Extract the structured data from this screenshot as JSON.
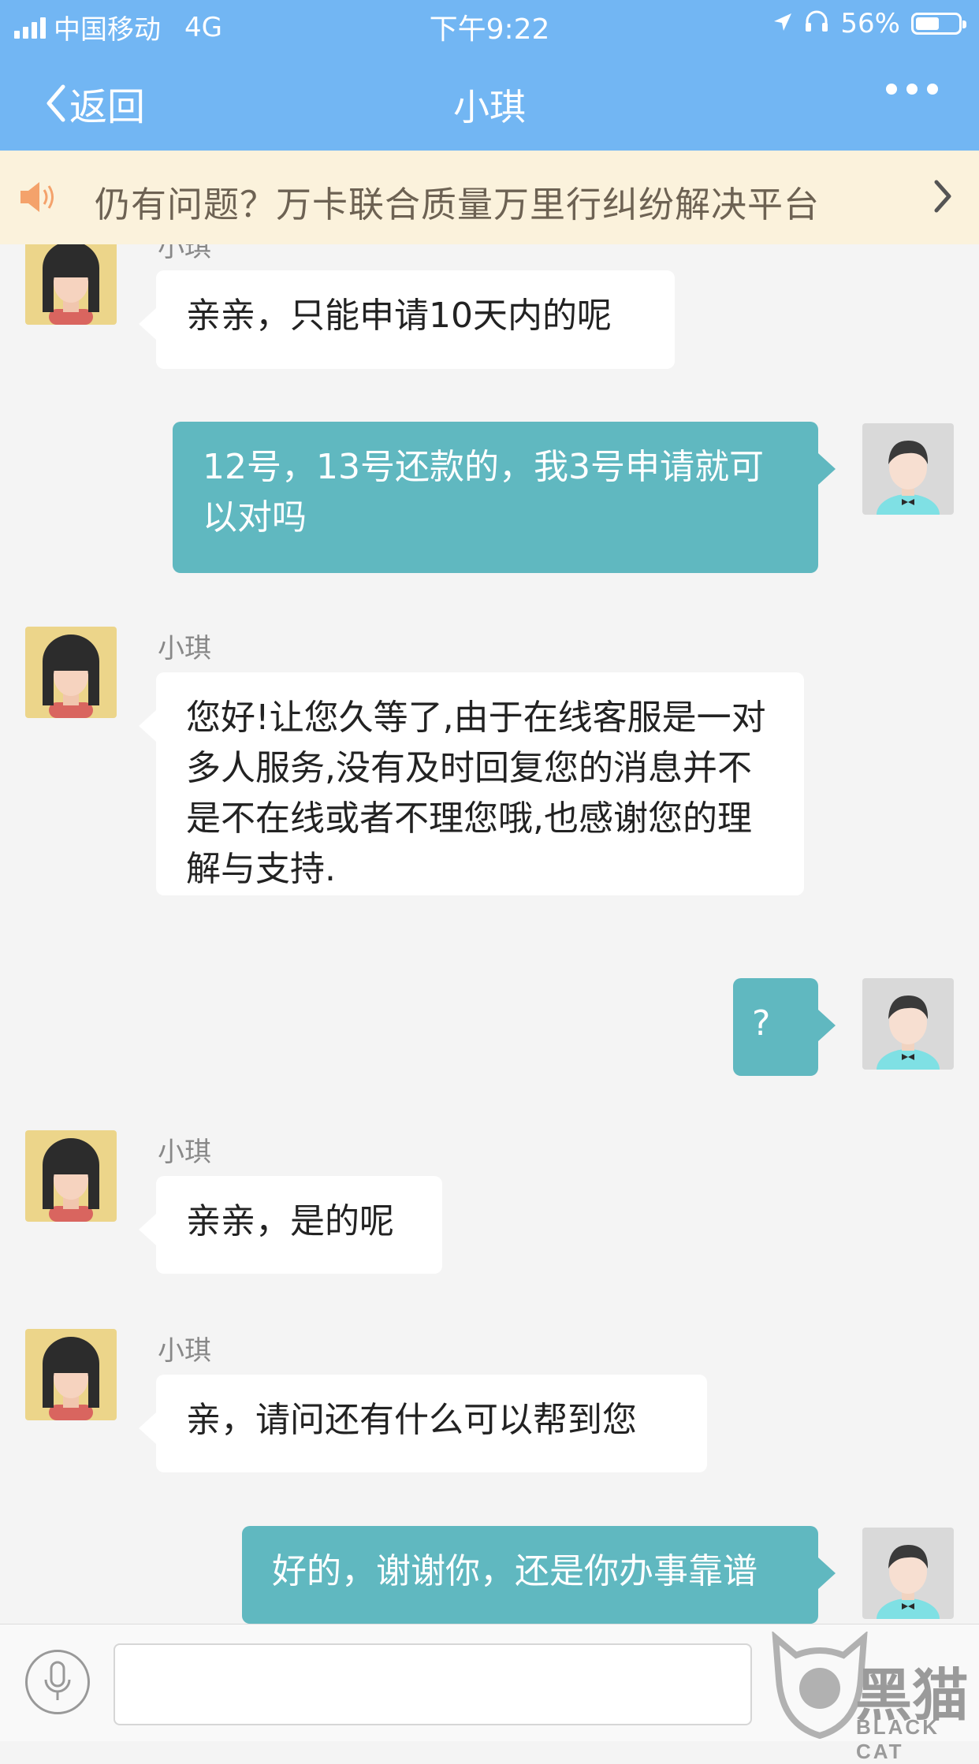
{
  "status_bar": {
    "carrier": "中国移动",
    "network": "4G",
    "time": "下午9:22",
    "battery": "56%",
    "battery_level": 0.56
  },
  "navbar": {
    "back_label": "返回",
    "title": "小琪"
  },
  "notice": {
    "text": "仍有问题？万卡联合质量万里行纠纷解决平台"
  },
  "messages": [
    {
      "from": "agent",
      "name": "小琪",
      "text": "亲亲，只能申请10天内的呢"
    },
    {
      "from": "user",
      "text": "12号，13号还款的，我3号申请就可以对吗"
    },
    {
      "from": "agent",
      "name": "小琪",
      "text": "您好!让您久等了,由于在线客服是一对多人服务,没有及时回复您的消息并不是不在线或者不理您哦,也感谢您的理解与支持."
    },
    {
      "from": "user",
      "text": "?"
    },
    {
      "from": "agent",
      "name": "小琪",
      "text": "亲亲，是的呢"
    },
    {
      "from": "agent",
      "name": "小琪",
      "text": "亲，请问还有什么可以帮到您"
    },
    {
      "from": "user",
      "text": "好的，谢谢你，还是你办事靠谱"
    }
  ],
  "input": {
    "value": "",
    "placeholder": ""
  },
  "watermark": {
    "text": "黑猫",
    "sub": "BLACK CAT"
  },
  "colors": {
    "header": "#72b6f3",
    "outgoing_bubble": "#60b8c0",
    "notice_bg": "#fbf2dc"
  }
}
